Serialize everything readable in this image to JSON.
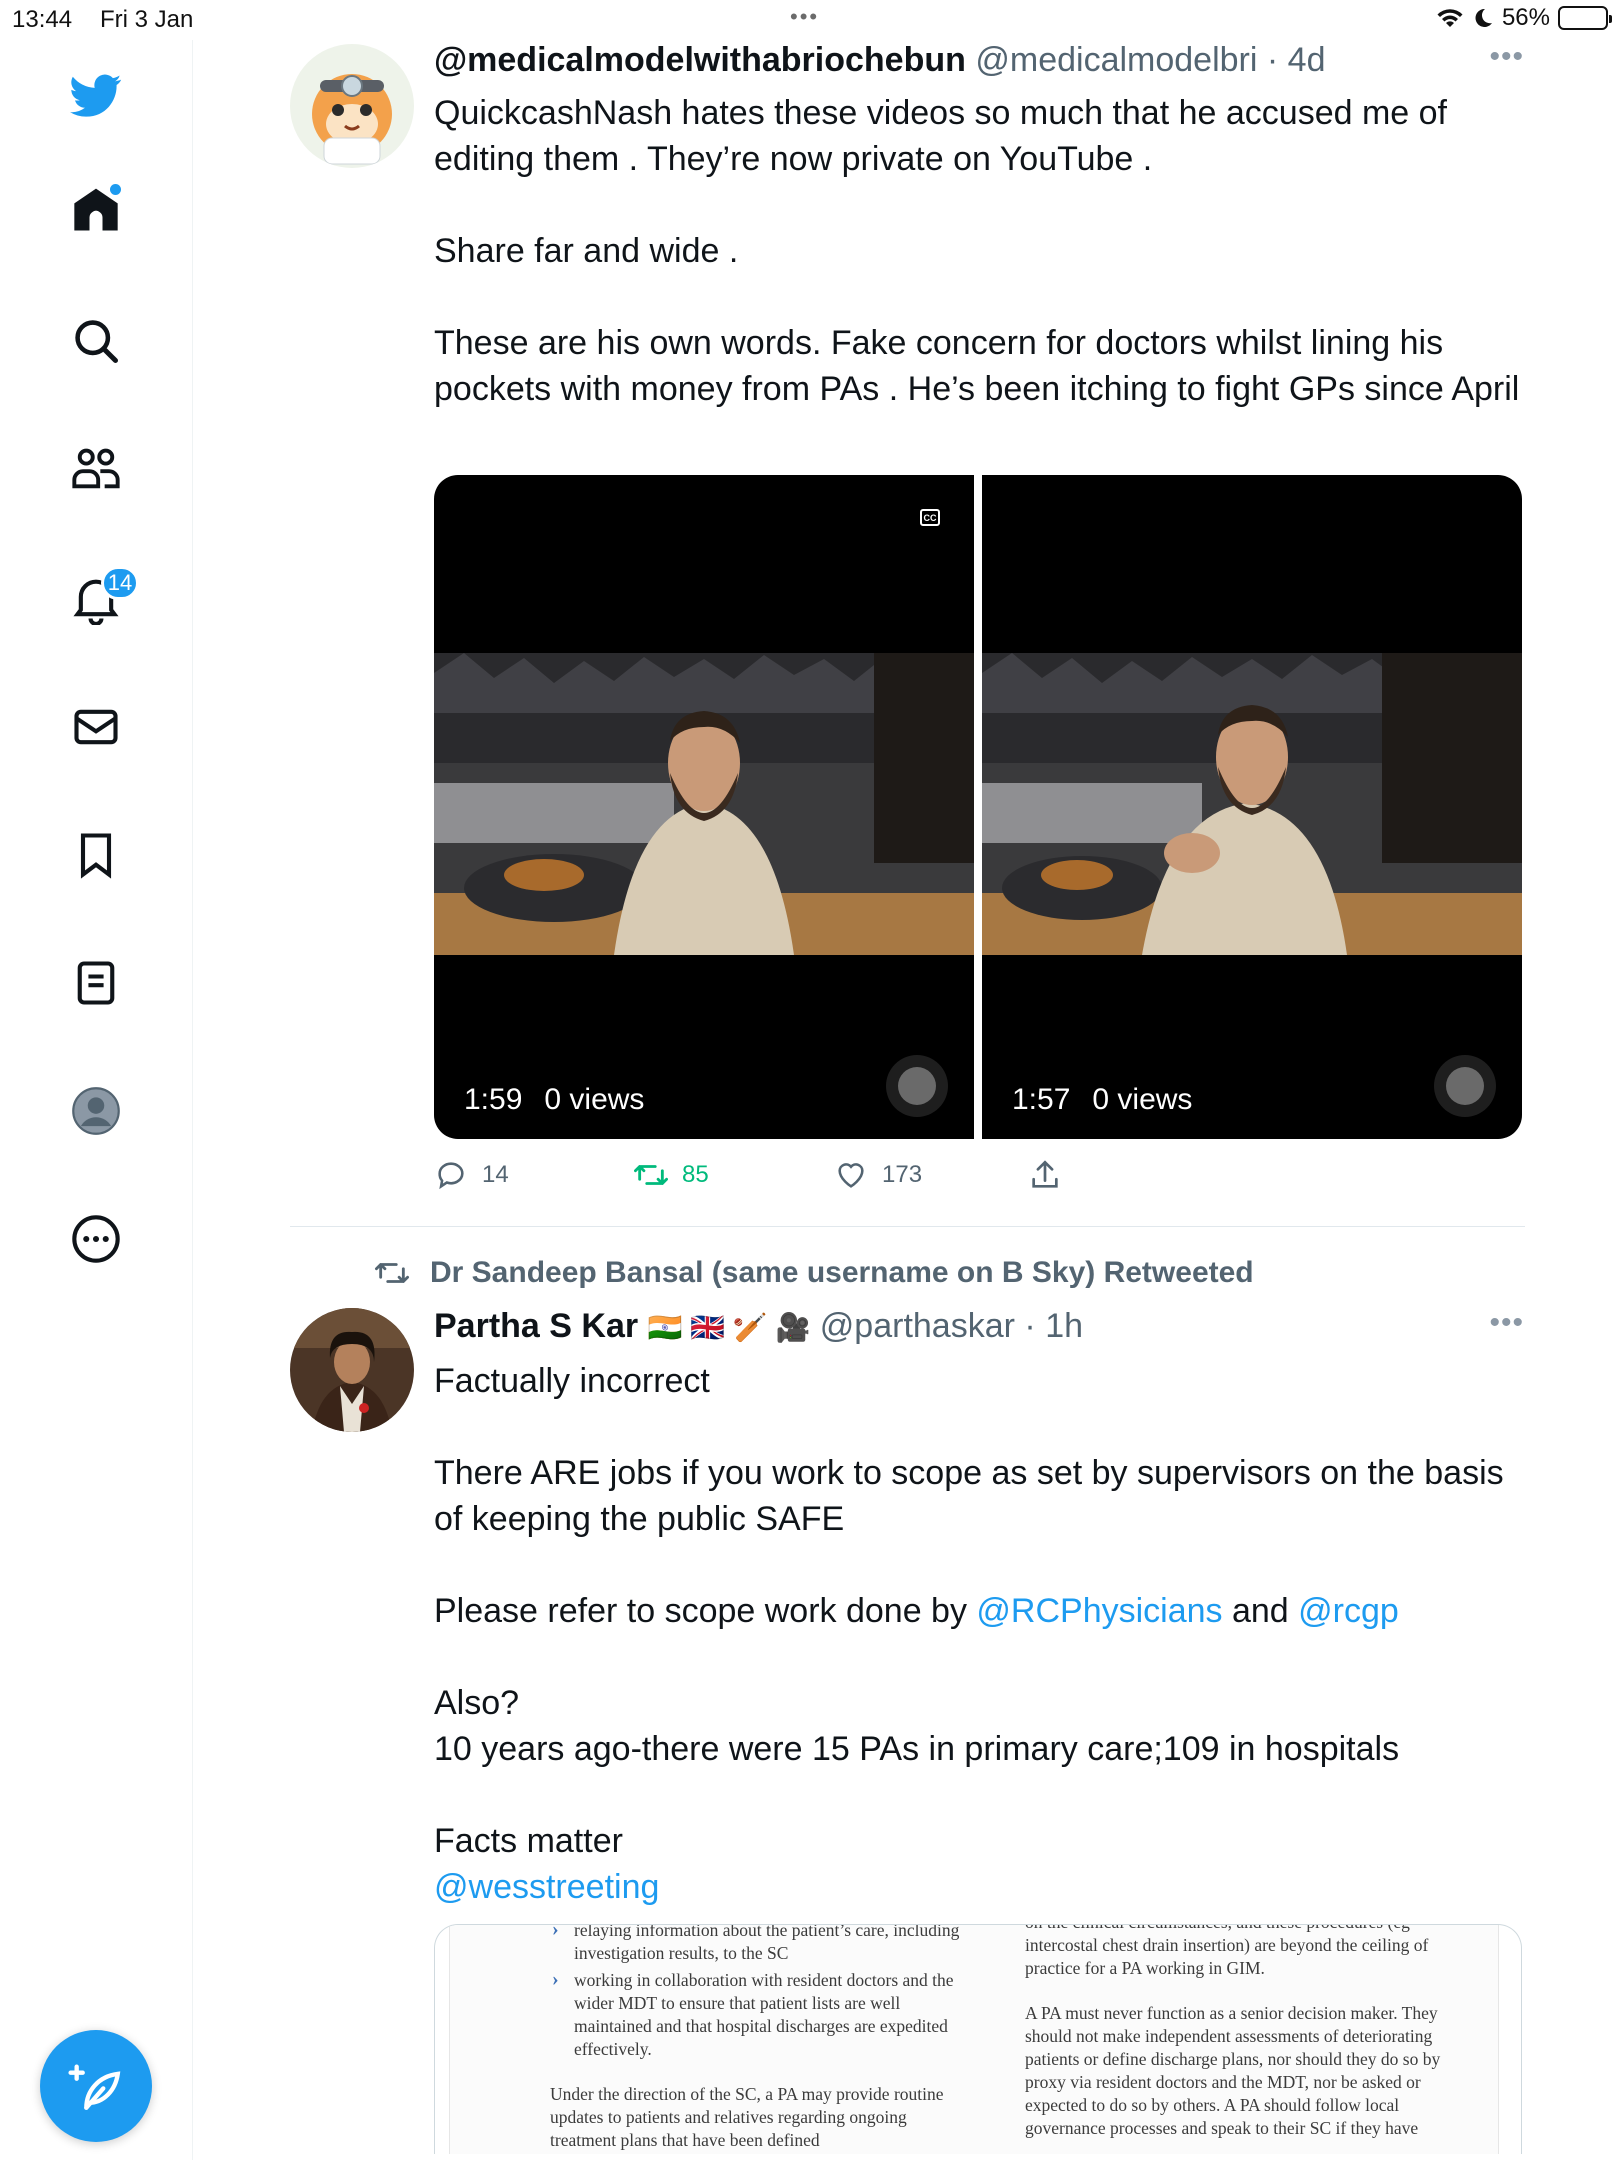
{
  "status_bar": {
    "time": "13:44",
    "date": "Fri 3 Jan",
    "battery_label": "56%",
    "battery_level": 0.56
  },
  "sidebar": {
    "items": [
      {
        "name": "twitter-logo",
        "icon": "twitter-bird-icon"
      },
      {
        "name": "home",
        "icon": "home-icon",
        "has_dot": true
      },
      {
        "name": "explore",
        "icon": "search-icon"
      },
      {
        "name": "communities",
        "icon": "people-icon"
      },
      {
        "name": "notifications",
        "icon": "bell-icon",
        "badge": "14"
      },
      {
        "name": "messages",
        "icon": "mail-icon"
      },
      {
        "name": "bookmarks",
        "icon": "bookmark-icon"
      },
      {
        "name": "lists",
        "icon": "list-icon"
      },
      {
        "name": "profile",
        "icon": "avatar-icon"
      },
      {
        "name": "more",
        "icon": "more-circle-icon"
      }
    ],
    "compose_icon": "compose-feather-icon",
    "accent": "#1d9bf0"
  },
  "tweet1": {
    "name": "@medicalmodelwithabriochebun",
    "handle": "@medicalmodelbri",
    "sep": "·",
    "time": "4d",
    "more": "•••",
    "lines": [
      "QuickcashNash hates these videos so much that he accused me of editing them . They’re now private on YouTube .",
      "",
      "Share far and wide .",
      "",
      "These are his own words. Fake concern for doctors whilst lining his pockets with money from PAs . He’s been itching to fight GPs since April"
    ],
    "videos": [
      {
        "duration": "1:59",
        "views": "0 views"
      },
      {
        "duration": "1:57",
        "views": "0 views"
      }
    ],
    "cc_label": "CC",
    "actions": {
      "replies": "14",
      "retweets": "85",
      "likes": "173"
    }
  },
  "retweet_banner": {
    "text": "Dr Sandeep Bansal (same username on B Sky) Retweeted"
  },
  "tweet2": {
    "name": "Partha S Kar",
    "emojis": "🇮🇳 🇬🇧 🏏 🎥",
    "handle": "@parthaskar",
    "sep": "·",
    "time": "1h",
    "more": "•••",
    "line1": "Factually incorrect",
    "line2": "There ARE jobs if you work to scope as set by supervisors on the basis of keeping the public SAFE",
    "line3_pre": "Please refer to scope work done by ",
    "mention1": "@RCPhysicians",
    "line3_mid": " and ",
    "mention2": "@rcgp",
    "line4": "Also?",
    "line5": "10 years ago-there were 15 PAs in primary care;109 in hospitals",
    "line6": "Facts matter",
    "mention3": "@wesstreeting",
    "doc": {
      "left_bullet1": "relaying information about the patient’s care, including investigation results, to the SC",
      "left_bullet2": "working in collaboration with resident doctors and the wider MDT to ensure that patient lists are well maintained and that hospital discharges are expedited effectively.",
      "left_para": "Under the direction of the SC, a PA may provide routine updates to patients and relatives regarding ongoing treatment plans that have been defined",
      "right_top": "on the clinical circumstances, and these procedures (eg intercostal chest drain insertion) are beyond the ceiling of practice for a PA working in GIM.",
      "right_para": "A PA must never function as a senior decision maker. They should not make independent assessments of deteriorating patients or define discharge plans, nor should they do so by proxy via resident doctors and the MDT, nor be asked or expected to do so by others. A PA should follow local governance processes and speak to their SC if they have"
    }
  }
}
